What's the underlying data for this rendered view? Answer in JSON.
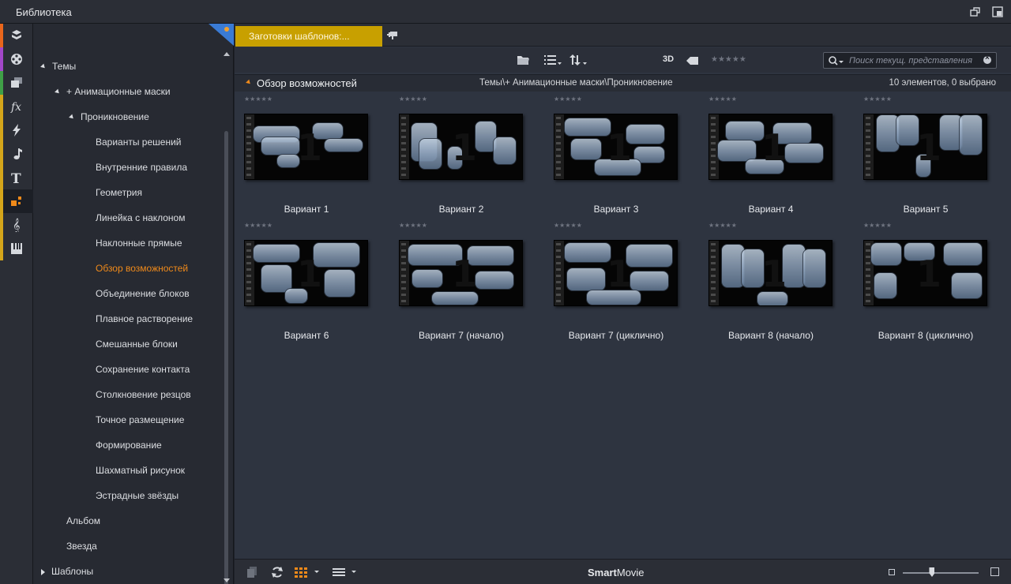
{
  "window": {
    "title": "Библиотека"
  },
  "strip": {
    "items": [
      {
        "name": "projects-icon",
        "color": "#e9661c"
      },
      {
        "name": "film-reel-icon",
        "color": "#a347c9"
      },
      {
        "name": "media-stack-icon",
        "color": "#3fa047"
      },
      {
        "name": "fx-icon",
        "color": "#d4a51a"
      },
      {
        "name": "lightning-icon",
        "color": "#d4a51a"
      },
      {
        "name": "music-note-icon",
        "color": "#d4a51a"
      },
      {
        "name": "title-t-icon",
        "color": "#d4a51a"
      },
      {
        "name": "montage-icon",
        "color": "#d4a51a"
      },
      {
        "name": "clef-icon",
        "color": "#d4a51a"
      },
      {
        "name": "piano-icon",
        "color": "#d4a51a"
      }
    ]
  },
  "tree": {
    "items": [
      {
        "label": "Темы",
        "toggle": "down"
      },
      {
        "label": "+ Анимационные маски",
        "toggle": "down"
      },
      {
        "label": "Проникновение",
        "toggle": "down"
      },
      {
        "label": "Варианты решений"
      },
      {
        "label": "Внутренние правила"
      },
      {
        "label": "Геометрия"
      },
      {
        "label": "Линейка с наклоном"
      },
      {
        "label": "Наклонные прямые"
      },
      {
        "label": "Обзор возможностей",
        "selected": true
      },
      {
        "label": "Объединение блоков"
      },
      {
        "label": "Плавное растворение"
      },
      {
        "label": "Смешанные блоки"
      },
      {
        "label": "Сохранение контакта"
      },
      {
        "label": "Столкновение резцов"
      },
      {
        "label": "Точное размещение"
      },
      {
        "label": "Формирование"
      },
      {
        "label": "Шахматный рисунок"
      },
      {
        "label": "Эстрадные звёзды"
      },
      {
        "label": "Альбом"
      },
      {
        "label": "Звезда"
      },
      {
        "label": "Шаблоны",
        "toggle": "right"
      }
    ]
  },
  "tabs": {
    "active_label": "Заготовки шаблонов:..."
  },
  "toolbar": {
    "threed_label": "3D",
    "rating_stars": "★★★★★",
    "search_placeholder": "Поиск текущ. представления",
    "search_value": ""
  },
  "pathbar": {
    "section": "Обзор возможностей",
    "breadcrumb": "Темы\\+ Анимационные маски\\Проникновение",
    "count": "10 элементов, 0 выбрано"
  },
  "items": [
    {
      "label": "Вариант 1",
      "stars": "★★★★★"
    },
    {
      "label": "Вариант 2",
      "stars": "★★★★★"
    },
    {
      "label": "Вариант 3",
      "stars": "★★★★★"
    },
    {
      "label": "Вариант 4",
      "stars": "★★★★★"
    },
    {
      "label": "Вариант 5",
      "stars": "★★★★★"
    },
    {
      "label": "Вариант 6",
      "stars": "★★★★★"
    },
    {
      "label": "Вариант 7 (начало)",
      "stars": "★★★★★"
    },
    {
      "label": "Вариант 7 (циклично)",
      "stars": "★★★★★"
    },
    {
      "label": "Вариант 8 (начало)",
      "stars": "★★★★★"
    },
    {
      "label": "Вариант 8 (циклично)",
      "stars": "★★★★★"
    }
  ],
  "thumb_digit": "1",
  "bottom": {
    "brand_bold": "Smart",
    "brand_rest": "Movie",
    "zoom_level": 0.38
  },
  "colors": {
    "accent": "#f08a1a",
    "tab": "#c8a000"
  }
}
